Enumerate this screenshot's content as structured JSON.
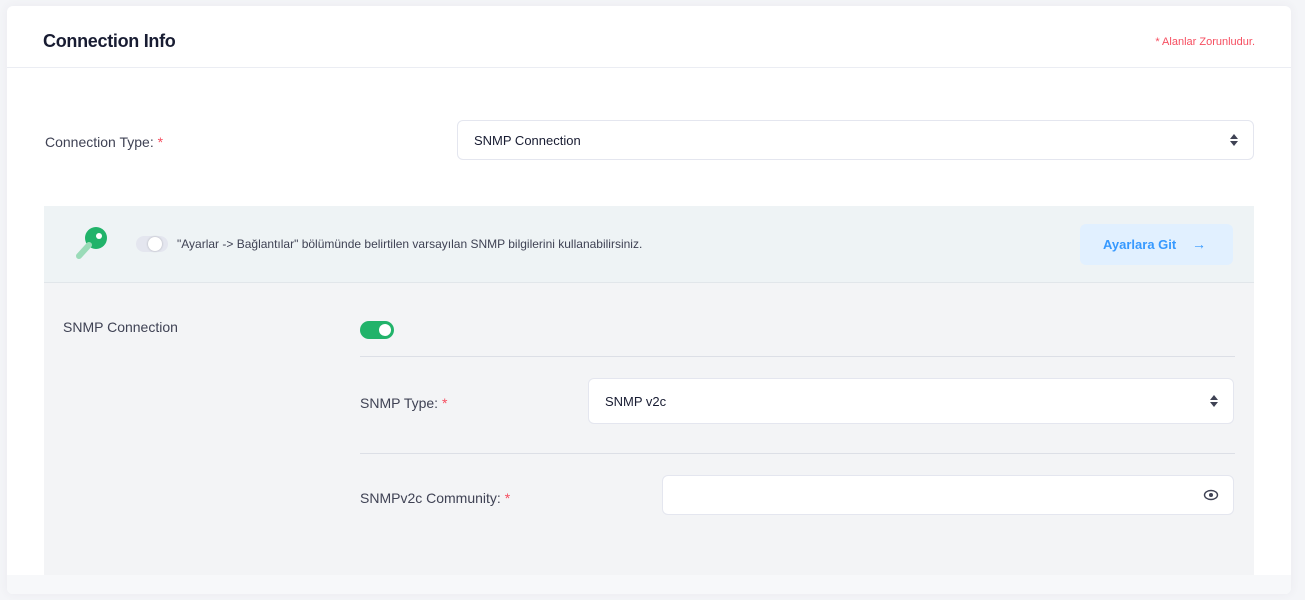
{
  "header": {
    "title": "Connection Info",
    "required_note": "* Alanlar Zorunludur."
  },
  "connection_type": {
    "label": "Connection Type:",
    "required_mark": "*",
    "selected": "SNMP Connection"
  },
  "info_bar": {
    "icon": "key-icon",
    "toggle_on": false,
    "text": "\"Ayarlar -> Bağlantılar\" bölümünde belirtilen varsayılan SNMP bilgilerini kullanabilirsiniz.",
    "button_label": "Ayarlara Git",
    "button_arrow": "→"
  },
  "snmp": {
    "section_label": "SNMP Connection",
    "toggle_on": true,
    "type_label": "SNMP Type:",
    "type_required_mark": "*",
    "type_selected": "SNMP v2c",
    "community_label": "SNMPv2c Community:",
    "community_required_mark": "*",
    "community_value": "",
    "community_icon": "eye-icon"
  },
  "colors": {
    "required": "#f64e60",
    "toggle_on": "#21b36a",
    "button_bg": "#e1f0ff",
    "button_text": "#3699ff",
    "key_icon": "#21b36a"
  }
}
